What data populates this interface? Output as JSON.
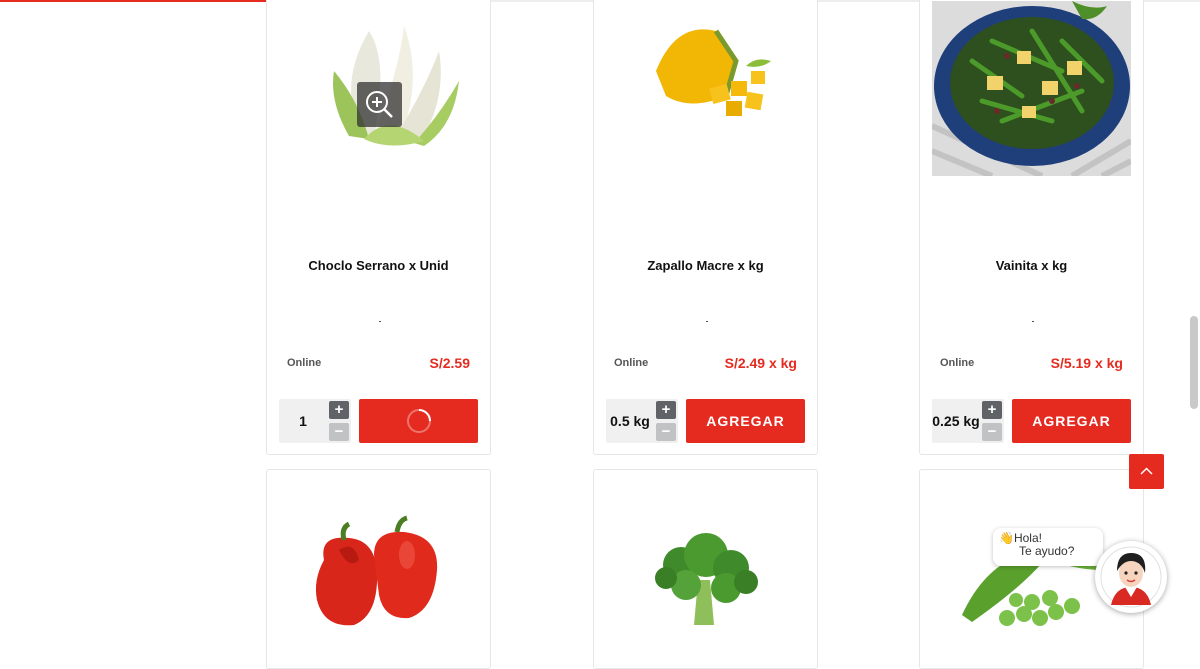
{
  "progress": {
    "value": 0.4
  },
  "products": [
    {
      "name": "Choclo Serrano x Unid",
      "availability": "Online",
      "price": "S/2.59",
      "quantity": "1",
      "button_label": "",
      "button_state": "loading",
      "image": "corn-image"
    },
    {
      "name": "Zapallo Macre x kg",
      "availability": "Online",
      "price": "S/2.49 x kg",
      "quantity": "0.5 kg",
      "button_label": "AGREGAR",
      "image": "pumpkin-image"
    },
    {
      "name": "Vainita x kg",
      "availability": "Online",
      "price": "S/5.19 x kg",
      "quantity": "0.25 kg",
      "button_label": "AGREGAR",
      "image": "green-bean-salad-image"
    }
  ],
  "products_row2": [
    {
      "image": "red-pepper-image"
    },
    {
      "image": "broccoli-image"
    },
    {
      "image": "peas-image"
    }
  ],
  "stepper": {
    "plus": "+",
    "minus": "−"
  },
  "chat": {
    "greeting": "Hola!",
    "subtitle": "Te ayudo?"
  },
  "colors": {
    "accent": "#e52b20",
    "stepper_dark": "#5f6368"
  }
}
